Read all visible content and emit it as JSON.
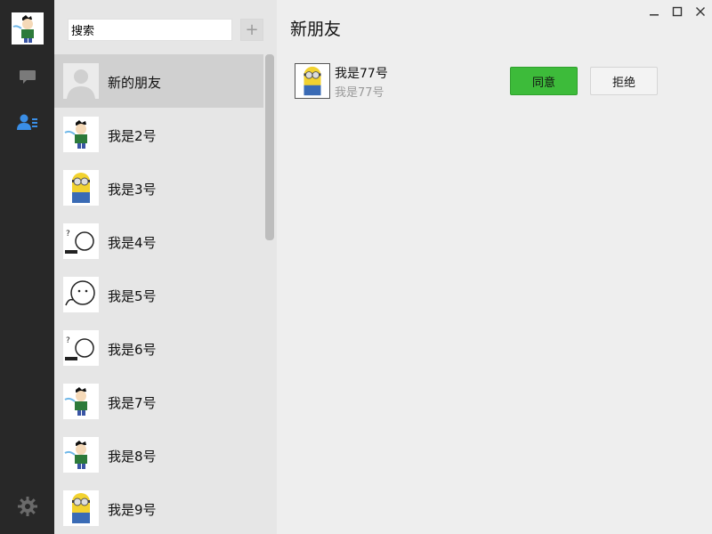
{
  "sidebar": {
    "nav": [
      "chat-icon",
      "contacts-icon",
      "settings-icon"
    ],
    "active_color": "#3a8ee6"
  },
  "search": {
    "value": "搜索",
    "add_label": "+"
  },
  "contacts": [
    {
      "name": "新的朋友",
      "avatar": "placeholder-avatar"
    },
    {
      "name": "我是2号",
      "avatar": "cartoon-boy-avatar"
    },
    {
      "name": "我是3号",
      "avatar": "minion-avatar"
    },
    {
      "name": "我是4号",
      "avatar": "doodle-face-avatar"
    },
    {
      "name": "我是5号",
      "avatar": "doodle-face-avatar"
    },
    {
      "name": "我是6号",
      "avatar": "doodle-face-avatar"
    },
    {
      "name": "我是7号",
      "avatar": "cartoon-boy-avatar"
    },
    {
      "name": "我是8号",
      "avatar": "cartoon-boy-avatar"
    },
    {
      "name": "我是9号",
      "avatar": "minion-avatar"
    }
  ],
  "main": {
    "title": "新朋友",
    "request": {
      "name": "我是77号",
      "subtitle": "我是77号",
      "agree_label": "同意",
      "reject_label": "拒绝"
    }
  },
  "window_controls": [
    "minimize-icon",
    "maximize-icon",
    "close-icon"
  ],
  "colors": {
    "agree": "#3dbb3a",
    "rail": "#282828",
    "selected": "#d0d0d0"
  }
}
